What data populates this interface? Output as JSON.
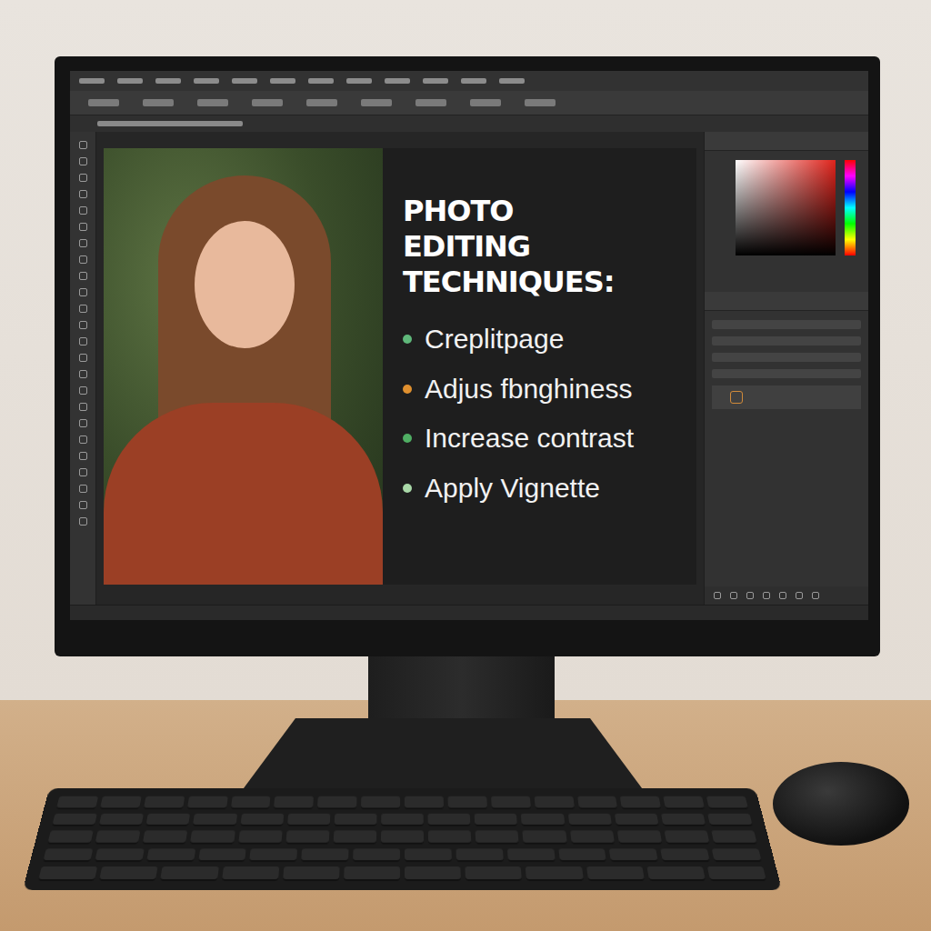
{
  "screen": {
    "slide": {
      "title": "PHOTO EDITING TECHNIQUES:",
      "items": [
        {
          "label": "Creplitpage",
          "color": "#5fb87a"
        },
        {
          "label": "Adjus fbnghiness",
          "color": "#e0902f"
        },
        {
          "label": "Increase contrast",
          "color": "#4fae63"
        },
        {
          "label": "Apply Vignette",
          "color": "#a9d8a8"
        }
      ]
    }
  }
}
